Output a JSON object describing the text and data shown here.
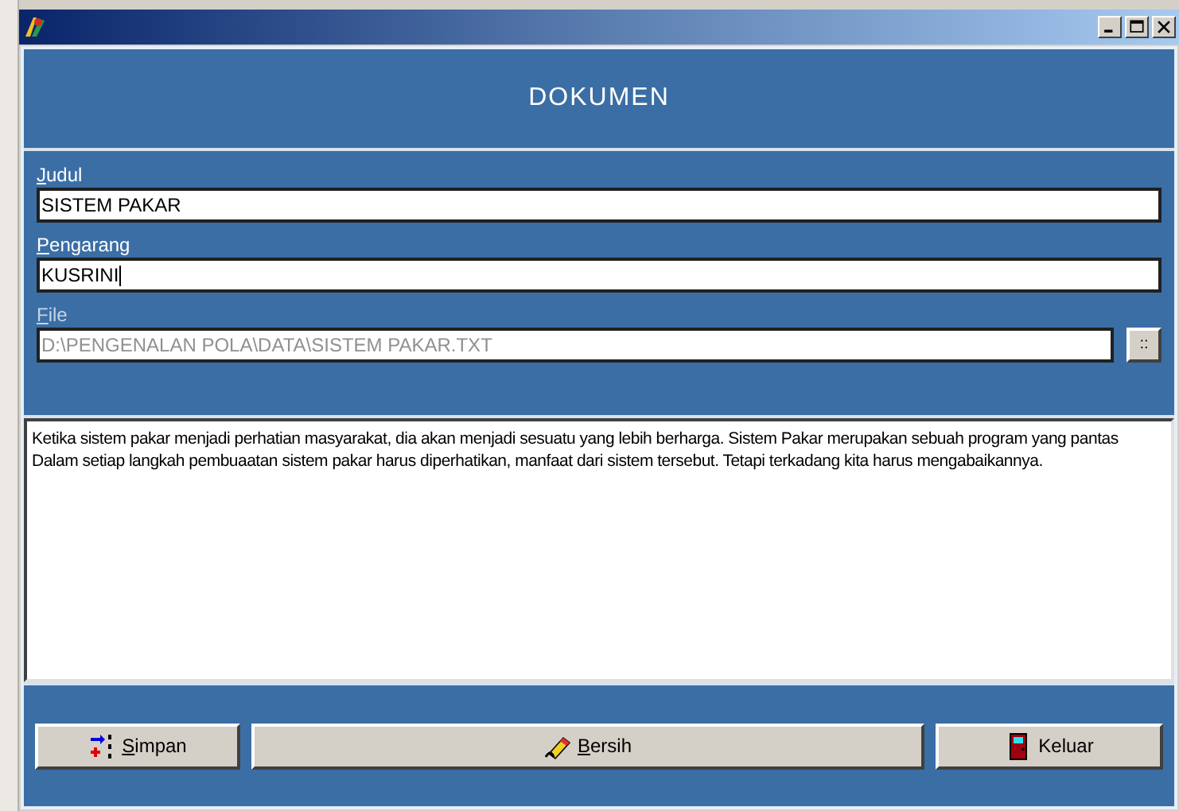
{
  "header": {
    "title": "DOKUMEN"
  },
  "fields": [
    {
      "label": "Judul",
      "underline_first": true,
      "value": "SISTEM PAKAR",
      "disabled": false,
      "has_browse": false
    },
    {
      "label": "Pengarang",
      "underline_first": true,
      "value": "KUSRINI",
      "disabled": false,
      "has_browse": false,
      "focused": true
    },
    {
      "label": "File",
      "underline_first": true,
      "value": "D:\\PENGENALAN POLA\\DATA\\SISTEM PAKAR.TXT",
      "disabled": true,
      "has_browse": true,
      "browse_label": "::"
    }
  ],
  "memo": {
    "lines": [
      "Ketika sistem pakar menjadi perhatian masyarakat, dia akan menjadi sesuatu yang lebih berharga. Sistem Pakar merupakan sebuah program yang pantas",
      "Dalam setiap langkah pembuaatan sistem pakar harus diperhatikan, manfaat dari sistem tersebut. Tetapi terkadang kita harus mengabaikannya."
    ]
  },
  "buttons": [
    {
      "kind": "save",
      "label": "Simpan",
      "underline_first": true
    },
    {
      "kind": "clear",
      "label": "Bersih",
      "underline_first": true
    },
    {
      "kind": "exit",
      "label": "Keluar",
      "underline_first": false
    }
  ]
}
